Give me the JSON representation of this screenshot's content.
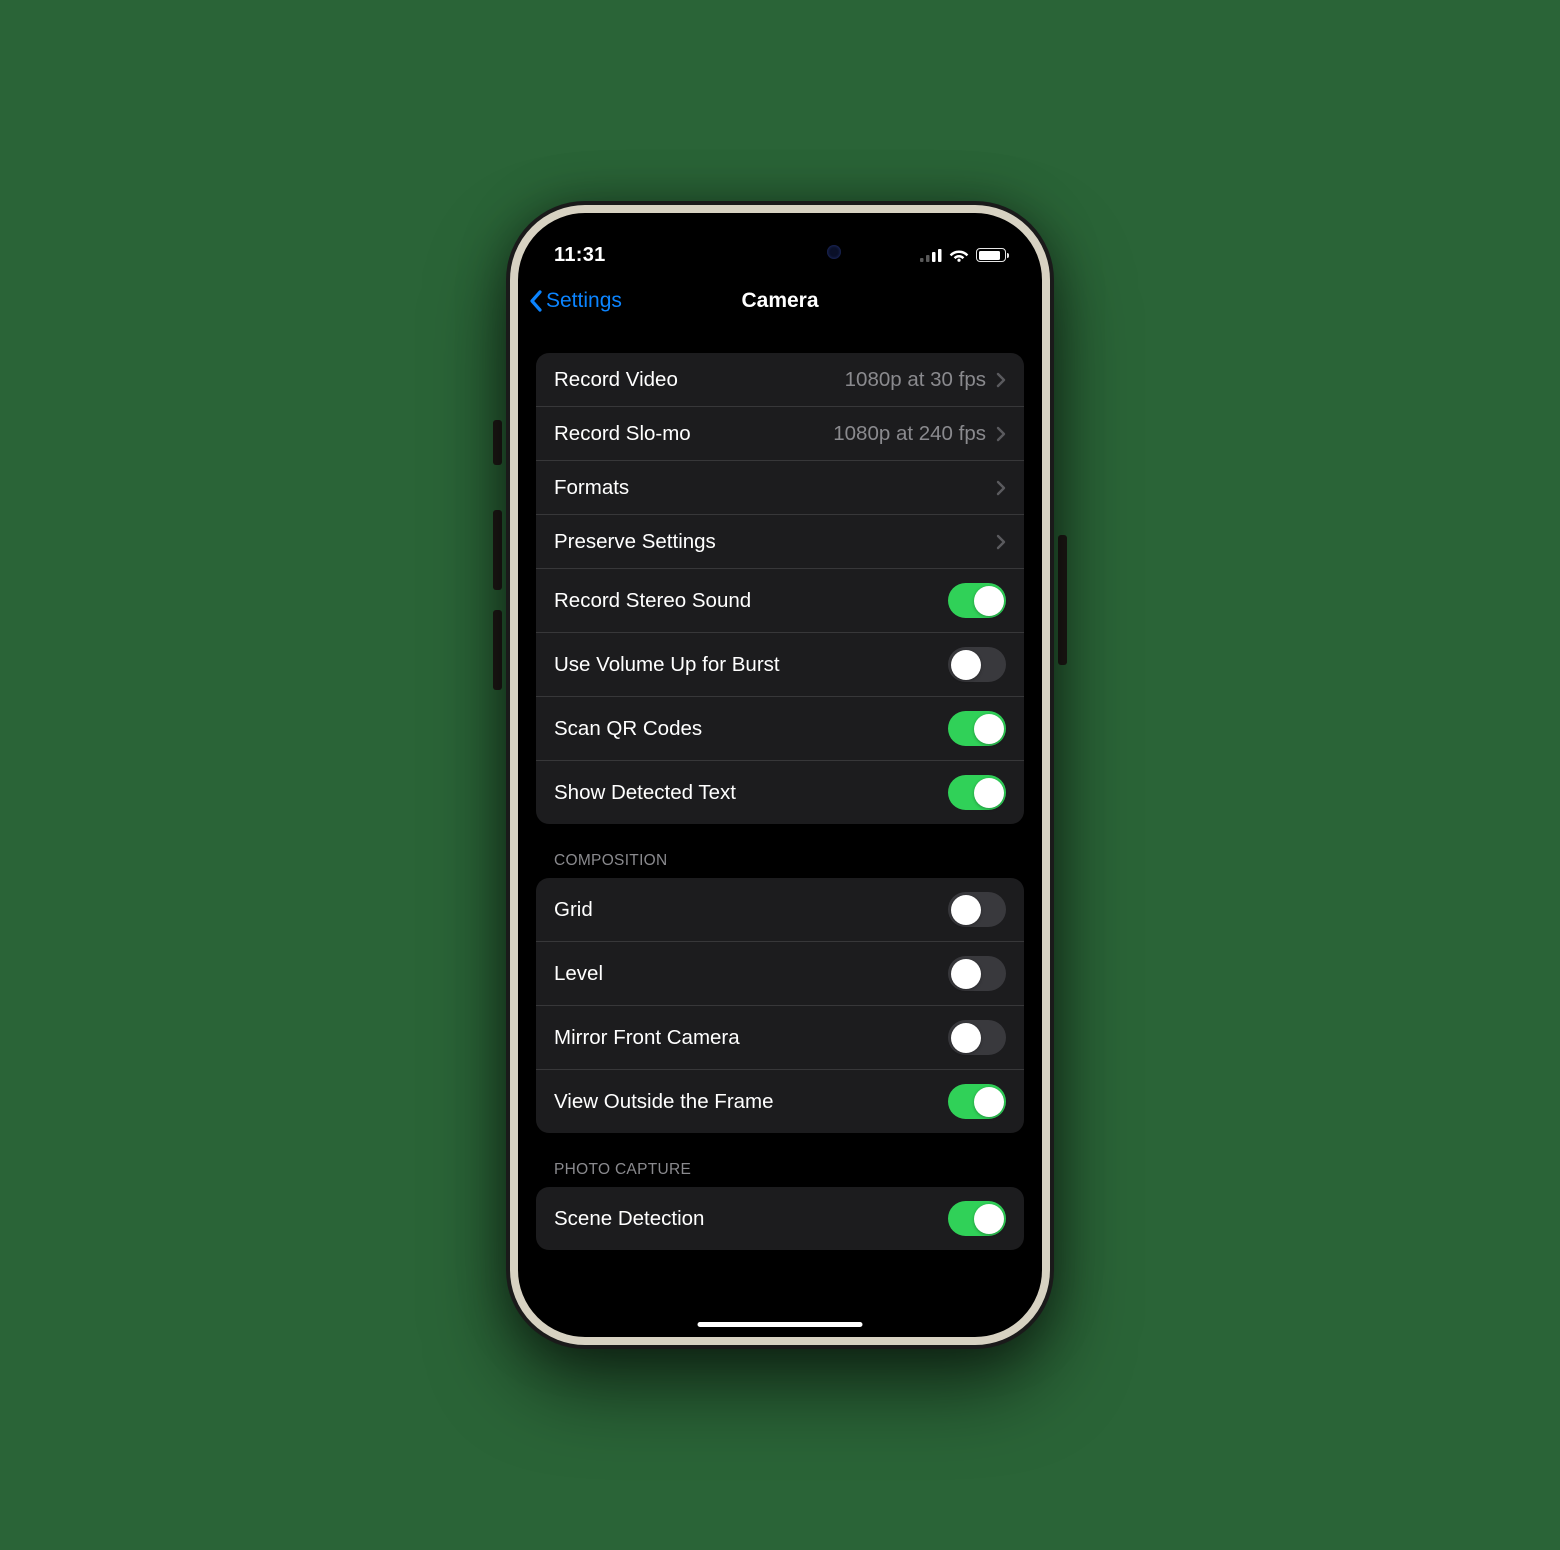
{
  "status": {
    "time": "11:31"
  },
  "nav": {
    "back_label": "Settings",
    "title": "Camera"
  },
  "colors": {
    "accent": "#0b84ff",
    "toggle_on": "#30d158"
  },
  "section1": {
    "rows": [
      {
        "label": "Record Video",
        "type": "link",
        "value": "1080p at 30 fps"
      },
      {
        "label": "Record Slo-mo",
        "type": "link",
        "value": "1080p at 240 fps"
      },
      {
        "label": "Formats",
        "type": "link",
        "value": ""
      },
      {
        "label": "Preserve Settings",
        "type": "link",
        "value": ""
      },
      {
        "label": "Record Stereo Sound",
        "type": "toggle",
        "on": true
      },
      {
        "label": "Use Volume Up for Burst",
        "type": "toggle",
        "on": false
      },
      {
        "label": "Scan QR Codes",
        "type": "toggle",
        "on": true
      },
      {
        "label": "Show Detected Text",
        "type": "toggle",
        "on": true
      }
    ]
  },
  "section2": {
    "header": "COMPOSITION",
    "rows": [
      {
        "label": "Grid",
        "type": "toggle",
        "on": false
      },
      {
        "label": "Level",
        "type": "toggle",
        "on": false
      },
      {
        "label": "Mirror Front Camera",
        "type": "toggle",
        "on": false
      },
      {
        "label": "View Outside the Frame",
        "type": "toggle",
        "on": true
      }
    ]
  },
  "section3": {
    "header": "PHOTO CAPTURE",
    "rows": [
      {
        "label": "Scene Detection",
        "type": "toggle",
        "on": true
      }
    ]
  }
}
